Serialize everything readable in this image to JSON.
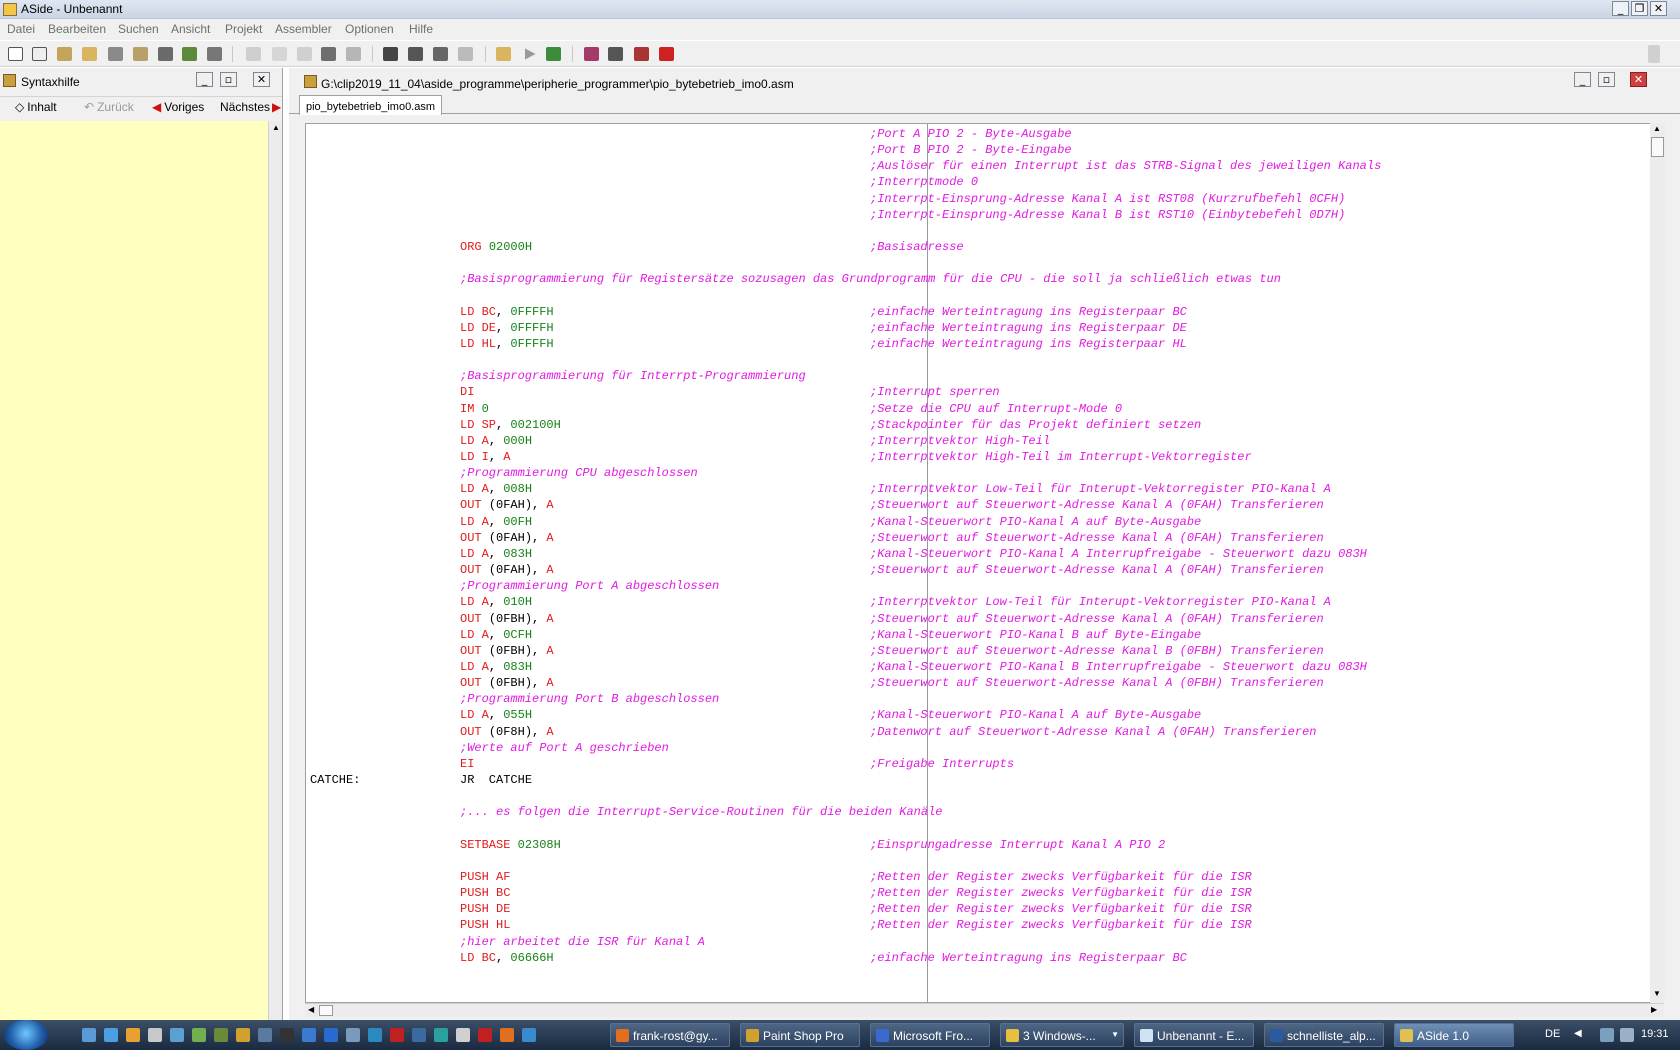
{
  "window": {
    "title": "ASide - Unbenannt"
  },
  "menu": [
    "Datei",
    "Bearbeiten",
    "Suchen",
    "Ansicht",
    "Projekt",
    "Assembler",
    "Optionen",
    "Hilfe"
  ],
  "left_panel": {
    "title": "Syntaxhilfe",
    "buttons": {
      "contents": "Inhalt",
      "back": "Zurück",
      "prev": "Voriges",
      "next": "Nächstes"
    }
  },
  "editor_window": {
    "path": "G:\\clip2019_11_04\\aside_programme\\peripherie_programmer\\pio_bytebetrieb_imo0.asm",
    "tab": "pio_bytebetrieb_imo0.asm"
  },
  "code": [
    {
      "comment": ";Port A PIO 2 - Byte-Ausgabe"
    },
    {
      "comment": ";Port B PIO 2 - Byte-Eingabe"
    },
    {
      "comment": ";Auslöser für einen Interrupt ist das STRB-Signal des jeweiligen Kanals"
    },
    {
      "comment": ";Interrptmode 0"
    },
    {
      "comment": ";Interrpt-Einsprung-Adresse Kanal A ist RST08 (Kurzrufbefehl 0CFH)"
    },
    {
      "comment": ";Interrpt-Einsprung-Adresse Kanal B ist RST10 (Einbytebefehl 0D7H)"
    },
    {},
    {
      "op": "ORG",
      "args": [
        {
          "t": "num",
          "v": "02000H"
        }
      ],
      "comment": ";Basisadresse"
    },
    {},
    {
      "wide": ";Basisprogrammierung für Registersätze sozusagen das Grundprogramm für die CPU - die soll ja schließlich etwas tun"
    },
    {},
    {
      "op": "LD",
      "args": [
        {
          "t": "kw",
          "v": "BC"
        },
        {
          "t": "plain",
          "v": ", "
        },
        {
          "t": "num",
          "v": "0FFFFH"
        }
      ],
      "comment": ";einfache Werteintragung ins Registerpaar BC"
    },
    {
      "op": "LD",
      "args": [
        {
          "t": "kw",
          "v": "DE"
        },
        {
          "t": "plain",
          "v": ", "
        },
        {
          "t": "num",
          "v": "0FFFFH"
        }
      ],
      "comment": ";einfache Werteintragung ins Registerpaar DE"
    },
    {
      "op": "LD",
      "args": [
        {
          "t": "kw",
          "v": "HL"
        },
        {
          "t": "plain",
          "v": ", "
        },
        {
          "t": "num",
          "v": "0FFFFH"
        }
      ],
      "comment": ";einfache Werteintragung ins Registerpaar HL"
    },
    {},
    {
      "wide": ";Basisprogrammierung für Interrpt-Programmierung"
    },
    {
      "op": "DI",
      "args": [],
      "comment": ";Interrupt sperren"
    },
    {
      "op": "IM",
      "args": [
        {
          "t": "num",
          "v": "0"
        }
      ],
      "comment": ";Setze die CPU auf Interrupt-Mode 0"
    },
    {
      "op": "LD",
      "args": [
        {
          "t": "kw",
          "v": "SP"
        },
        {
          "t": "plain",
          "v": ", "
        },
        {
          "t": "num",
          "v": "002100H"
        }
      ],
      "comment": ";Stackpointer für das Projekt definiert setzen"
    },
    {
      "op": "LD",
      "args": [
        {
          "t": "kw",
          "v": "A"
        },
        {
          "t": "plain",
          "v": ", "
        },
        {
          "t": "num",
          "v": "000H"
        }
      ],
      "comment": ";Interrptvektor High-Teil"
    },
    {
      "op": "LD",
      "args": [
        {
          "t": "kw",
          "v": "I"
        },
        {
          "t": "plain",
          "v": ", "
        },
        {
          "t": "kw",
          "v": "A"
        }
      ],
      "comment": ";Interrptvektor High-Teil im Interrupt-Vektorregister"
    },
    {
      "wide": ";Programmierung CPU abgeschlossen"
    },
    {
      "op": "LD",
      "args": [
        {
          "t": "kw",
          "v": "A"
        },
        {
          "t": "plain",
          "v": ", "
        },
        {
          "t": "num",
          "v": "008H"
        }
      ],
      "comment": ";Interrptvektor Low-Teil für Interupt-Vektorregister PIO-Kanal A"
    },
    {
      "op": "OUT",
      "args": [
        {
          "t": "plain",
          "v": "(0FAH), "
        },
        {
          "t": "kw",
          "v": "A"
        }
      ],
      "comment": ";Steuerwort auf Steuerwort-Adresse Kanal A (0FAH) Transferieren"
    },
    {
      "op": "LD",
      "args": [
        {
          "t": "kw",
          "v": "A"
        },
        {
          "t": "plain",
          "v": ", "
        },
        {
          "t": "num",
          "v": "00FH"
        }
      ],
      "comment": ";Kanal-Steuerwort PIO-Kanal A auf Byte-Ausgabe"
    },
    {
      "op": "OUT",
      "args": [
        {
          "t": "plain",
          "v": "(0FAH), "
        },
        {
          "t": "kw",
          "v": "A"
        }
      ],
      "comment": ";Steuerwort auf Steuerwort-Adresse Kanal A (0FAH) Transferieren"
    },
    {
      "op": "LD",
      "args": [
        {
          "t": "kw",
          "v": "A"
        },
        {
          "t": "plain",
          "v": ", "
        },
        {
          "t": "num",
          "v": "083H"
        }
      ],
      "comment": ";Kanal-Steuerwort PIO-Kanal A Interrupfreigabe - Steuerwort dazu 083H"
    },
    {
      "op": "OUT",
      "args": [
        {
          "t": "plain",
          "v": "(0FAH), "
        },
        {
          "t": "kw",
          "v": "A"
        }
      ],
      "comment": ";Steuerwort auf Steuerwort-Adresse Kanal A (0FAH) Transferieren"
    },
    {
      "wide": ";Programmierung Port A abgeschlossen"
    },
    {
      "op": "LD",
      "args": [
        {
          "t": "kw",
          "v": "A"
        },
        {
          "t": "plain",
          "v": ", "
        },
        {
          "t": "num",
          "v": "010H"
        }
      ],
      "comment": ";Interrptvektor Low-Teil für Interupt-Vektorregister PIO-Kanal A"
    },
    {
      "op": "OUT",
      "args": [
        {
          "t": "plain",
          "v": "(0FBH), "
        },
        {
          "t": "kw",
          "v": "A"
        }
      ],
      "comment": ";Steuerwort auf Steuerwort-Adresse Kanal A (0FAH) Transferieren"
    },
    {
      "op": "LD",
      "args": [
        {
          "t": "kw",
          "v": "A"
        },
        {
          "t": "plain",
          "v": ", "
        },
        {
          "t": "num",
          "v": "0CFH"
        }
      ],
      "comment": ";Kanal-Steuerwort PIO-Kanal B auf Byte-Eingabe"
    },
    {
      "op": "OUT",
      "args": [
        {
          "t": "plain",
          "v": "(0FBH), "
        },
        {
          "t": "kw",
          "v": "A"
        }
      ],
      "comment": ";Steuerwort auf Steuerwort-Adresse Kanal B (0FBH) Transferieren"
    },
    {
      "op": "LD",
      "args": [
        {
          "t": "kw",
          "v": "A"
        },
        {
          "t": "plain",
          "v": ", "
        },
        {
          "t": "num",
          "v": "083H"
        }
      ],
      "comment": ";Kanal-Steuerwort PIO-Kanal B Interrupfreigabe - Steuerwort dazu 083H"
    },
    {
      "op": "OUT",
      "args": [
        {
          "t": "plain",
          "v": "(0FBH), "
        },
        {
          "t": "kw",
          "v": "A"
        }
      ],
      "comment": ";Steuerwort auf Steuerwort-Adresse Kanal A (0FBH) Transferieren"
    },
    {
      "wide": ";Programmierung Port B abgeschlossen"
    },
    {
      "op": "LD",
      "args": [
        {
          "t": "kw",
          "v": "A"
        },
        {
          "t": "plain",
          "v": ", "
        },
        {
          "t": "num",
          "v": "055H"
        }
      ],
      "comment": ";Kanal-Steuerwort PIO-Kanal A auf Byte-Ausgabe"
    },
    {
      "op": "OUT",
      "args": [
        {
          "t": "plain",
          "v": "(0F8H), "
        },
        {
          "t": "kw",
          "v": "A"
        }
      ],
      "comment": ";Datenwort auf Steuerwort-Adresse Kanal A (0FAH) Transferieren"
    },
    {
      "wide": ";Werte auf Port A geschrieben"
    },
    {
      "op": "EI",
      "args": [],
      "comment": ";Freigabe Interrupts"
    },
    {
      "label": "CATCHE:",
      "op": "JR",
      "args": [
        {
          "t": "plain",
          "v": " CATCHE"
        }
      ]
    },
    {},
    {
      "wide": ";... es folgen die Interrupt-Service-Routinen für die beiden Kanäle"
    },
    {},
    {
      "op": "SETBASE",
      "args": [
        {
          "t": "num",
          "v": "02308H"
        }
      ],
      "comment": ";Einsprungadresse Interrupt Kanal A PIO 2"
    },
    {},
    {
      "op": "PUSH",
      "args": [
        {
          "t": "kw",
          "v": "AF"
        }
      ],
      "comment": ";Retten der Register zwecks Verfügbarkeit für die ISR"
    },
    {
      "op": "PUSH",
      "args": [
        {
          "t": "kw",
          "v": "BC"
        }
      ],
      "comment": ";Retten der Register zwecks Verfügbarkeit für die ISR"
    },
    {
      "op": "PUSH",
      "args": [
        {
          "t": "kw",
          "v": "DE"
        }
      ],
      "comment": ";Retten der Register zwecks Verfügbarkeit für die ISR"
    },
    {
      "op": "PUSH",
      "args": [
        {
          "t": "kw",
          "v": "HL"
        }
      ],
      "comment": ";Retten der Register zwecks Verfügbarkeit für die ISR"
    },
    {
      "wide": ";hier arbeitet die ISR für Kanal A"
    },
    {
      "op": "LD",
      "args": [
        {
          "t": "kw",
          "v": "BC"
        },
        {
          "t": "plain",
          "v": ", "
        },
        {
          "t": "num",
          "v": "06666H"
        }
      ],
      "comment": ";einfache Werteintragung ins Registerpaar BC"
    }
  ],
  "taskbar": {
    "buttons": [
      "frank-rost@gy...",
      "Paint Shop Pro",
      "Microsoft Fro...",
      "3 Windows-...",
      "Unbenannt - E...",
      "schnelliste_alp...",
      "ASide 1.0"
    ],
    "lang": "DE",
    "clock": "19:31"
  }
}
